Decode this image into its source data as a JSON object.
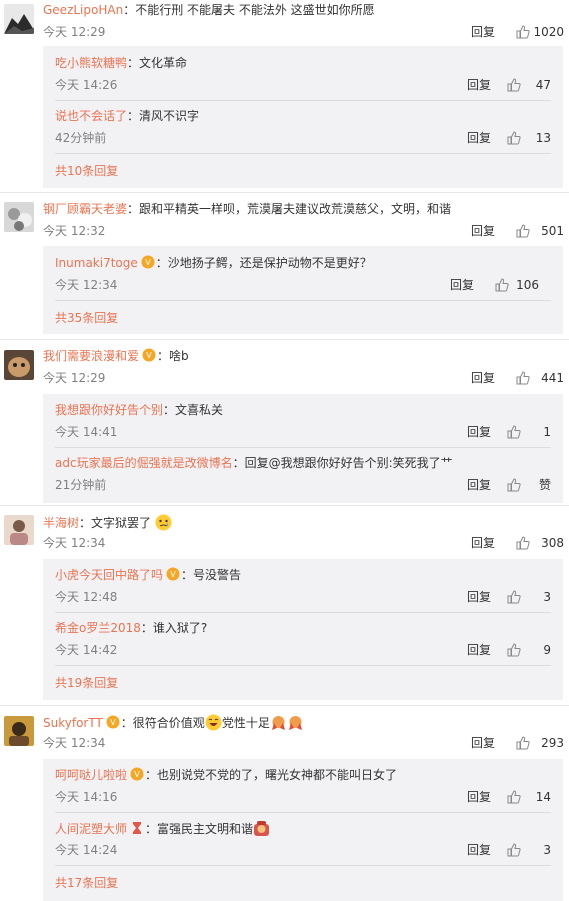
{
  "ui": {
    "reply_label": "回复"
  },
  "comments": [
    {
      "user": "GeezLipoHAn",
      "text": "：不能行刑 不能屠夫 不能法外 这盛世如你所愿",
      "time": "今天 12:29",
      "likes": "1020",
      "replies": [
        {
          "user": "吃小熊软糖鸭",
          "text": "：文化革命",
          "time": "今天 14:26",
          "likes": "47"
        },
        {
          "user": "说也不会话了",
          "text": "：清风不识字",
          "time": "42分钟前",
          "likes": "13"
        }
      ],
      "more": "共10条回复"
    },
    {
      "user": "钢厂顾霸天老婆",
      "text": "：跟和平精英一样呗，荒漠屠夫建议改荒漠慈父，文明，和谐",
      "time": "今天 12:32",
      "likes": "501",
      "replies": [
        {
          "user": "Inumaki7toge",
          "text": "：沙地扬子鳄，还是保护动物不是更好？",
          "time": "今天 12:34",
          "likes": "106"
        }
      ],
      "more": "共35条回复"
    },
    {
      "user": "我们需要浪漫和爱",
      "text": "：啥b",
      "time": "今天 12:29",
      "likes": "441",
      "replies": [
        {
          "user": "我想跟你好好告个别",
          "text": "：文喜私关",
          "time": "今天 14:41",
          "likes": "1"
        },
        {
          "user": "adc玩家最后的倔强就是改微博名",
          "text": "：回复@我想跟你好好告个别:笑死我了艹",
          "time": "21分钟前",
          "likes": "赞"
        }
      ],
      "more": ""
    },
    {
      "user": "半海树",
      "text": "：文字狱罢了",
      "time": "今天 12:34",
      "likes": "308",
      "replies": [
        {
          "user": "小虎今天回中路了吗",
          "text": "：号没警告",
          "time": "今天 12:48",
          "likes": "3"
        },
        {
          "user": "希金o罗兰2018",
          "text": "：谁入狱了?",
          "time": "今天 14:42",
          "likes": "9"
        }
      ],
      "more": "共19条回复"
    },
    {
      "user": "SukyforTT",
      "text": "：很符合价值观",
      "text2": "党性十足",
      "time": "今天 12:34",
      "likes": "293",
      "replies": [
        {
          "user": "呵呵哒儿啦啦",
          "text": "：也别说党不党的了，曙光女神都不能叫日女了",
          "time": "今天 14:16",
          "likes": "14"
        },
        {
          "user": "人间泥塑大师",
          "text": "：富强民主文明和谐",
          "time": "今天 14:24",
          "likes": "3"
        }
      ],
      "more": "共17条回复"
    }
  ],
  "colors": {
    "username": "#eb7350",
    "sub_bg": "#f2f2f5",
    "meta": "#808080"
  },
  "icons": [
    "thumb-up-icon",
    "vip-badge-icon",
    "emoji-icon",
    "avatar"
  ]
}
